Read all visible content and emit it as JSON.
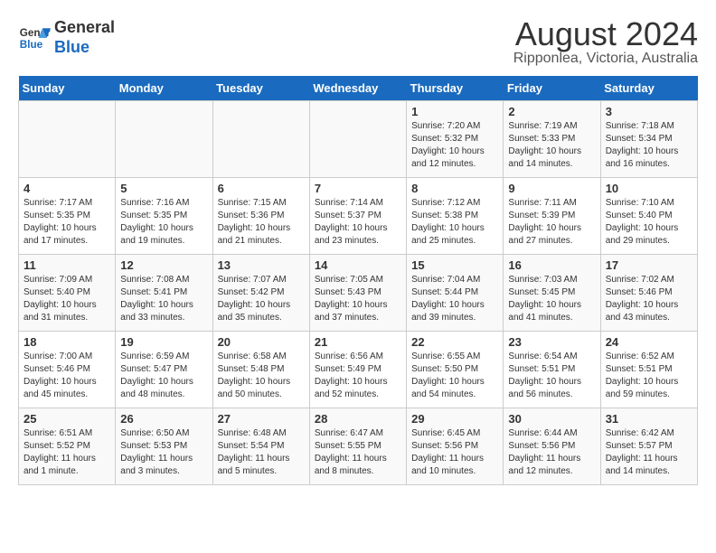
{
  "logo": {
    "line1": "General",
    "line2": "Blue"
  },
  "title": "August 2024",
  "subtitle": "Ripponlea, Victoria, Australia",
  "days_of_week": [
    "Sunday",
    "Monday",
    "Tuesday",
    "Wednesday",
    "Thursday",
    "Friday",
    "Saturday"
  ],
  "weeks": [
    [
      {
        "day": "",
        "info": ""
      },
      {
        "day": "",
        "info": ""
      },
      {
        "day": "",
        "info": ""
      },
      {
        "day": "",
        "info": ""
      },
      {
        "day": "1",
        "info": "Sunrise: 7:20 AM\nSunset: 5:32 PM\nDaylight: 10 hours\nand 12 minutes."
      },
      {
        "day": "2",
        "info": "Sunrise: 7:19 AM\nSunset: 5:33 PM\nDaylight: 10 hours\nand 14 minutes."
      },
      {
        "day": "3",
        "info": "Sunrise: 7:18 AM\nSunset: 5:34 PM\nDaylight: 10 hours\nand 16 minutes."
      }
    ],
    [
      {
        "day": "4",
        "info": "Sunrise: 7:17 AM\nSunset: 5:35 PM\nDaylight: 10 hours\nand 17 minutes."
      },
      {
        "day": "5",
        "info": "Sunrise: 7:16 AM\nSunset: 5:35 PM\nDaylight: 10 hours\nand 19 minutes."
      },
      {
        "day": "6",
        "info": "Sunrise: 7:15 AM\nSunset: 5:36 PM\nDaylight: 10 hours\nand 21 minutes."
      },
      {
        "day": "7",
        "info": "Sunrise: 7:14 AM\nSunset: 5:37 PM\nDaylight: 10 hours\nand 23 minutes."
      },
      {
        "day": "8",
        "info": "Sunrise: 7:12 AM\nSunset: 5:38 PM\nDaylight: 10 hours\nand 25 minutes."
      },
      {
        "day": "9",
        "info": "Sunrise: 7:11 AM\nSunset: 5:39 PM\nDaylight: 10 hours\nand 27 minutes."
      },
      {
        "day": "10",
        "info": "Sunrise: 7:10 AM\nSunset: 5:40 PM\nDaylight: 10 hours\nand 29 minutes."
      }
    ],
    [
      {
        "day": "11",
        "info": "Sunrise: 7:09 AM\nSunset: 5:40 PM\nDaylight: 10 hours\nand 31 minutes."
      },
      {
        "day": "12",
        "info": "Sunrise: 7:08 AM\nSunset: 5:41 PM\nDaylight: 10 hours\nand 33 minutes."
      },
      {
        "day": "13",
        "info": "Sunrise: 7:07 AM\nSunset: 5:42 PM\nDaylight: 10 hours\nand 35 minutes."
      },
      {
        "day": "14",
        "info": "Sunrise: 7:05 AM\nSunset: 5:43 PM\nDaylight: 10 hours\nand 37 minutes."
      },
      {
        "day": "15",
        "info": "Sunrise: 7:04 AM\nSunset: 5:44 PM\nDaylight: 10 hours\nand 39 minutes."
      },
      {
        "day": "16",
        "info": "Sunrise: 7:03 AM\nSunset: 5:45 PM\nDaylight: 10 hours\nand 41 minutes."
      },
      {
        "day": "17",
        "info": "Sunrise: 7:02 AM\nSunset: 5:46 PM\nDaylight: 10 hours\nand 43 minutes."
      }
    ],
    [
      {
        "day": "18",
        "info": "Sunrise: 7:00 AM\nSunset: 5:46 PM\nDaylight: 10 hours\nand 45 minutes."
      },
      {
        "day": "19",
        "info": "Sunrise: 6:59 AM\nSunset: 5:47 PM\nDaylight: 10 hours\nand 48 minutes."
      },
      {
        "day": "20",
        "info": "Sunrise: 6:58 AM\nSunset: 5:48 PM\nDaylight: 10 hours\nand 50 minutes."
      },
      {
        "day": "21",
        "info": "Sunrise: 6:56 AM\nSunset: 5:49 PM\nDaylight: 10 hours\nand 52 minutes."
      },
      {
        "day": "22",
        "info": "Sunrise: 6:55 AM\nSunset: 5:50 PM\nDaylight: 10 hours\nand 54 minutes."
      },
      {
        "day": "23",
        "info": "Sunrise: 6:54 AM\nSunset: 5:51 PM\nDaylight: 10 hours\nand 56 minutes."
      },
      {
        "day": "24",
        "info": "Sunrise: 6:52 AM\nSunset: 5:51 PM\nDaylight: 10 hours\nand 59 minutes."
      }
    ],
    [
      {
        "day": "25",
        "info": "Sunrise: 6:51 AM\nSunset: 5:52 PM\nDaylight: 11 hours\nand 1 minute."
      },
      {
        "day": "26",
        "info": "Sunrise: 6:50 AM\nSunset: 5:53 PM\nDaylight: 11 hours\nand 3 minutes."
      },
      {
        "day": "27",
        "info": "Sunrise: 6:48 AM\nSunset: 5:54 PM\nDaylight: 11 hours\nand 5 minutes."
      },
      {
        "day": "28",
        "info": "Sunrise: 6:47 AM\nSunset: 5:55 PM\nDaylight: 11 hours\nand 8 minutes."
      },
      {
        "day": "29",
        "info": "Sunrise: 6:45 AM\nSunset: 5:56 PM\nDaylight: 11 hours\nand 10 minutes."
      },
      {
        "day": "30",
        "info": "Sunrise: 6:44 AM\nSunset: 5:56 PM\nDaylight: 11 hours\nand 12 minutes."
      },
      {
        "day": "31",
        "info": "Sunrise: 6:42 AM\nSunset: 5:57 PM\nDaylight: 11 hours\nand 14 minutes."
      }
    ]
  ]
}
